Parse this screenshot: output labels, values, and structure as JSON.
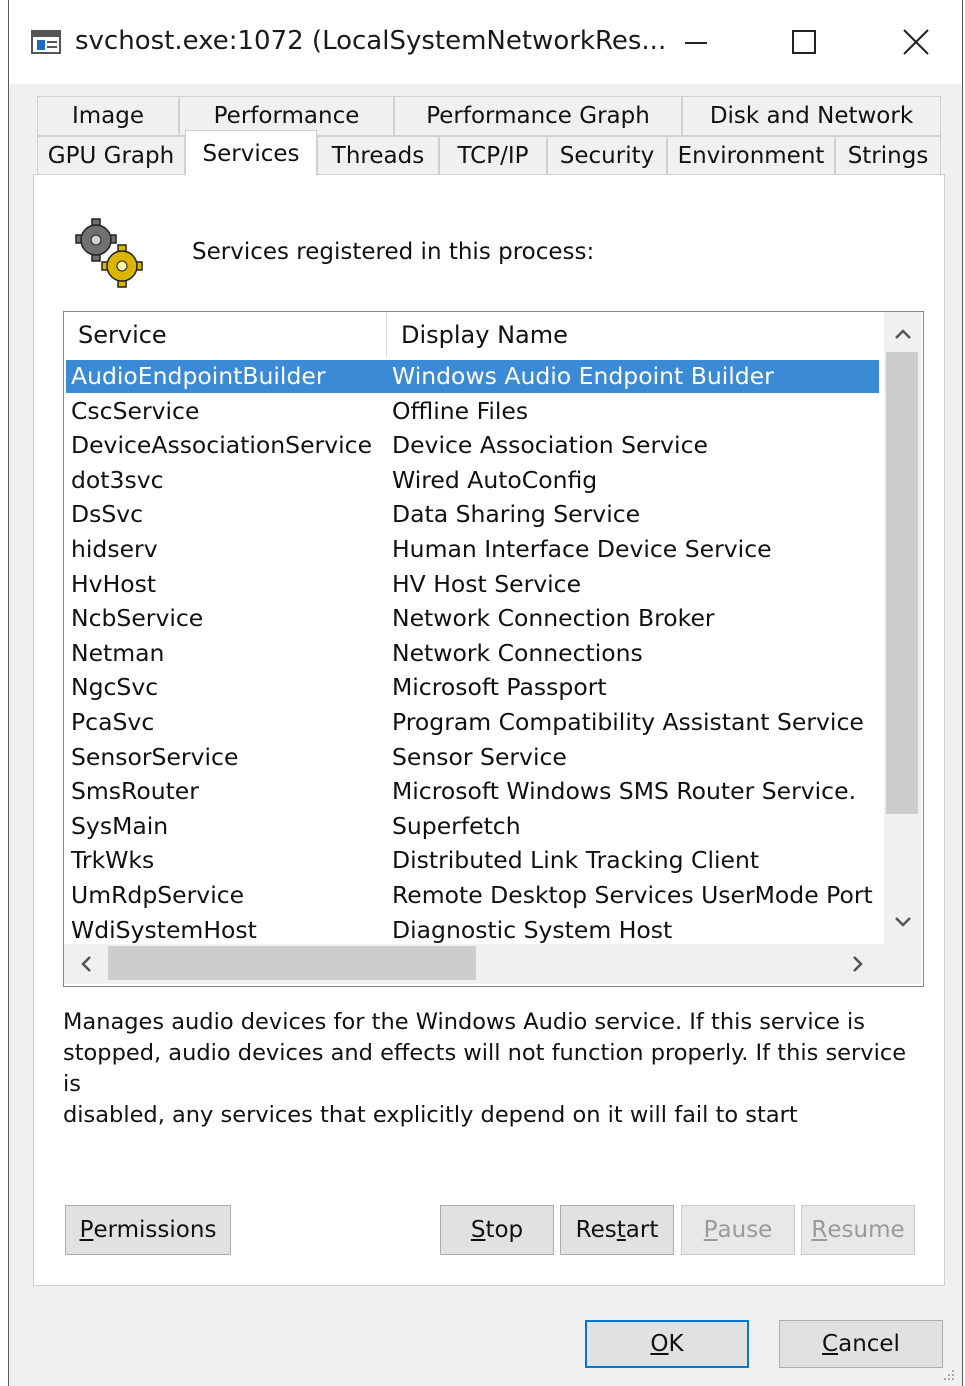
{
  "window": {
    "title": "svchost.exe:1072 (LocalSystemNetworkRes..."
  },
  "tabs_row1": [
    "Image",
    "Performance",
    "Performance Graph",
    "Disk and Network"
  ],
  "tabs_row2": [
    "GPU Graph",
    "Services",
    "Threads",
    "TCP/IP",
    "Security",
    "Environment",
    "Strings"
  ],
  "active_tab": "Services",
  "caption": "Services registered in this process:",
  "list": {
    "columns": [
      "Service",
      "Display Name"
    ],
    "rows": [
      {
        "service": "AudioEndpointBuilder",
        "display": "Windows Audio Endpoint Builder",
        "selected": true
      },
      {
        "service": "CscService",
        "display": "Offline Files"
      },
      {
        "service": "DeviceAssociationService",
        "display": "Device Association Service"
      },
      {
        "service": "dot3svc",
        "display": "Wired AutoConfig"
      },
      {
        "service": "DsSvc",
        "display": "Data Sharing Service"
      },
      {
        "service": "hidserv",
        "display": "Human Interface Device Service"
      },
      {
        "service": "HvHost",
        "display": "HV Host Service"
      },
      {
        "service": "NcbService",
        "display": "Network Connection Broker"
      },
      {
        "service": "Netman",
        "display": "Network Connections"
      },
      {
        "service": "NgcSvc",
        "display": "Microsoft Passport"
      },
      {
        "service": "PcaSvc",
        "display": "Program Compatibility Assistant Service"
      },
      {
        "service": "SensorService",
        "display": "Sensor Service"
      },
      {
        "service": "SmsRouter",
        "display": "Microsoft Windows SMS Router Service."
      },
      {
        "service": "SysMain",
        "display": "Superfetch"
      },
      {
        "service": "TrkWks",
        "display": "Distributed Link Tracking Client"
      },
      {
        "service": "UmRdpService",
        "display": "Remote Desktop Services UserMode Port"
      },
      {
        "service": "WdiSystemHost",
        "display": "Diagnostic System Host"
      }
    ]
  },
  "description": "Manages audio devices for the Windows Audio service.  If this service is\nstopped, audio devices and effects will not function properly.  If this service is\ndisabled, any services that explicitly depend on it will fail to start",
  "buttons": {
    "permissions": {
      "pre": "",
      "key": "P",
      "post": "ermissions"
    },
    "stop": {
      "pre": "",
      "key": "S",
      "post": "top"
    },
    "restart": {
      "pre": "Res",
      "key": "t",
      "post": "art"
    },
    "pause": {
      "pre": "",
      "key": "P",
      "post": "ause"
    },
    "resume": {
      "pre": "",
      "key": "R",
      "post": "esume"
    },
    "ok": {
      "pre": "",
      "key": "O",
      "post": "K"
    },
    "cancel": {
      "pre": "",
      "key": "C",
      "post": "ancel"
    }
  },
  "colors": {
    "selection": "#3a8ad6",
    "default_button_border": "#0078d7"
  }
}
